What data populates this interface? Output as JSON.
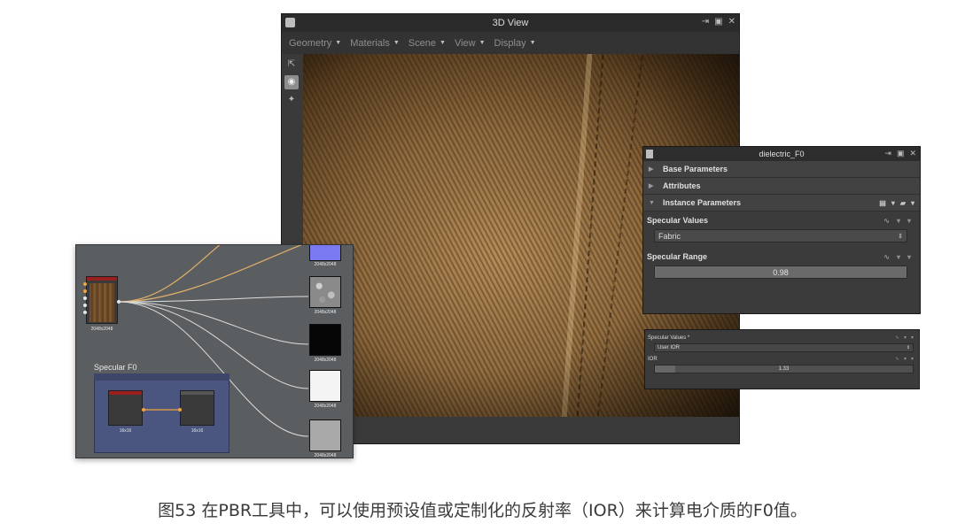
{
  "view3d": {
    "title": "3D View",
    "menus": [
      "Geometry",
      "Materials",
      "Scene",
      "View",
      "Display"
    ],
    "window_buttons": [
      "pin-icon",
      "float-icon",
      "close-icon"
    ]
  },
  "params_panel": {
    "title": "dielectric_F0",
    "sections": {
      "base": "Base Parameters",
      "attributes": "Attributes",
      "instance": "Instance Parameters"
    },
    "specular_values_label": "Specular Values",
    "specular_values_selected": "Fabric",
    "specular_range_label": "Specular Range",
    "specular_range_value": "0.98",
    "specular_range_fraction": 1.0
  },
  "ior_panel": {
    "specular_values_label": "Specular Values *",
    "specular_values_selected": "User IOR",
    "ior_label": "IOR",
    "ior_value": "1.33",
    "ior_fraction": 0.08
  },
  "graph": {
    "source_node_label": "2048x2048",
    "outputs": [
      {
        "label": "2048x2048",
        "kind": "normal"
      },
      {
        "label": "2048x2048",
        "kind": "noise"
      },
      {
        "label": "2048x2048",
        "kind": "black"
      },
      {
        "label": "2048x2048",
        "kind": "white"
      },
      {
        "label": "2048x2048",
        "kind": "grey"
      }
    ],
    "frame_title": "Specular F0",
    "frame_nodes": [
      {
        "label": "16x16"
      },
      {
        "label": "16x16"
      }
    ]
  },
  "caption": "图53 在PBR工具中，可以使用预设值或定制化的反射率（IOR）来计算电介质的F0值。",
  "colors": {
    "wire": "#f2a33a",
    "frame": "#4a5580",
    "node_header": "#9a1f1f"
  }
}
